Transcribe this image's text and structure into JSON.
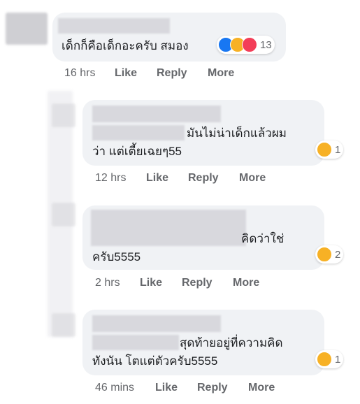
{
  "comments": [
    {
      "text_lines": [
        "เด็กก็คือเด็กอะครับ สมอง"
      ],
      "reactions": {
        "icons": [
          "like-icon",
          "haha-icon",
          "love-icon"
        ],
        "count": "13"
      },
      "meta": {
        "time": "16 hrs",
        "like": "Like",
        "reply": "Reply",
        "more": "More"
      }
    },
    {
      "text_lines": [
        "มันไม่น่าเด็กแล้วผม",
        "ว่า แต่เตี้ยเฉยๆ55"
      ],
      "reactions": {
        "icons": [
          "haha-icon"
        ],
        "count": "1"
      },
      "meta": {
        "time": "12 hrs",
        "like": "Like",
        "reply": "Reply",
        "more": "More"
      }
    },
    {
      "text_lines": [
        "คิดว่าใช่",
        "ครับ5555"
      ],
      "reactions": {
        "icons": [
          "haha-icon"
        ],
        "count": "2"
      },
      "meta": {
        "time": "2 hrs",
        "like": "Like",
        "reply": "Reply",
        "more": "More"
      }
    },
    {
      "text_lines": [
        "สุดท้ายอยู่ที่ความคิด",
        "ทังนัน โตแต่ตัวครับ5555"
      ],
      "reactions": {
        "icons": [
          "haha-icon"
        ],
        "count": "1"
      },
      "meta": {
        "time": "46 mins",
        "like": "Like",
        "reply": "Reply",
        "more": "More"
      }
    }
  ],
  "colors": {
    "bubble": "#f0f2f5",
    "meta_text": "#65676b",
    "like_blue": "#1877f2",
    "haha_yellow": "#f7b125",
    "love_red": "#f33e58"
  }
}
